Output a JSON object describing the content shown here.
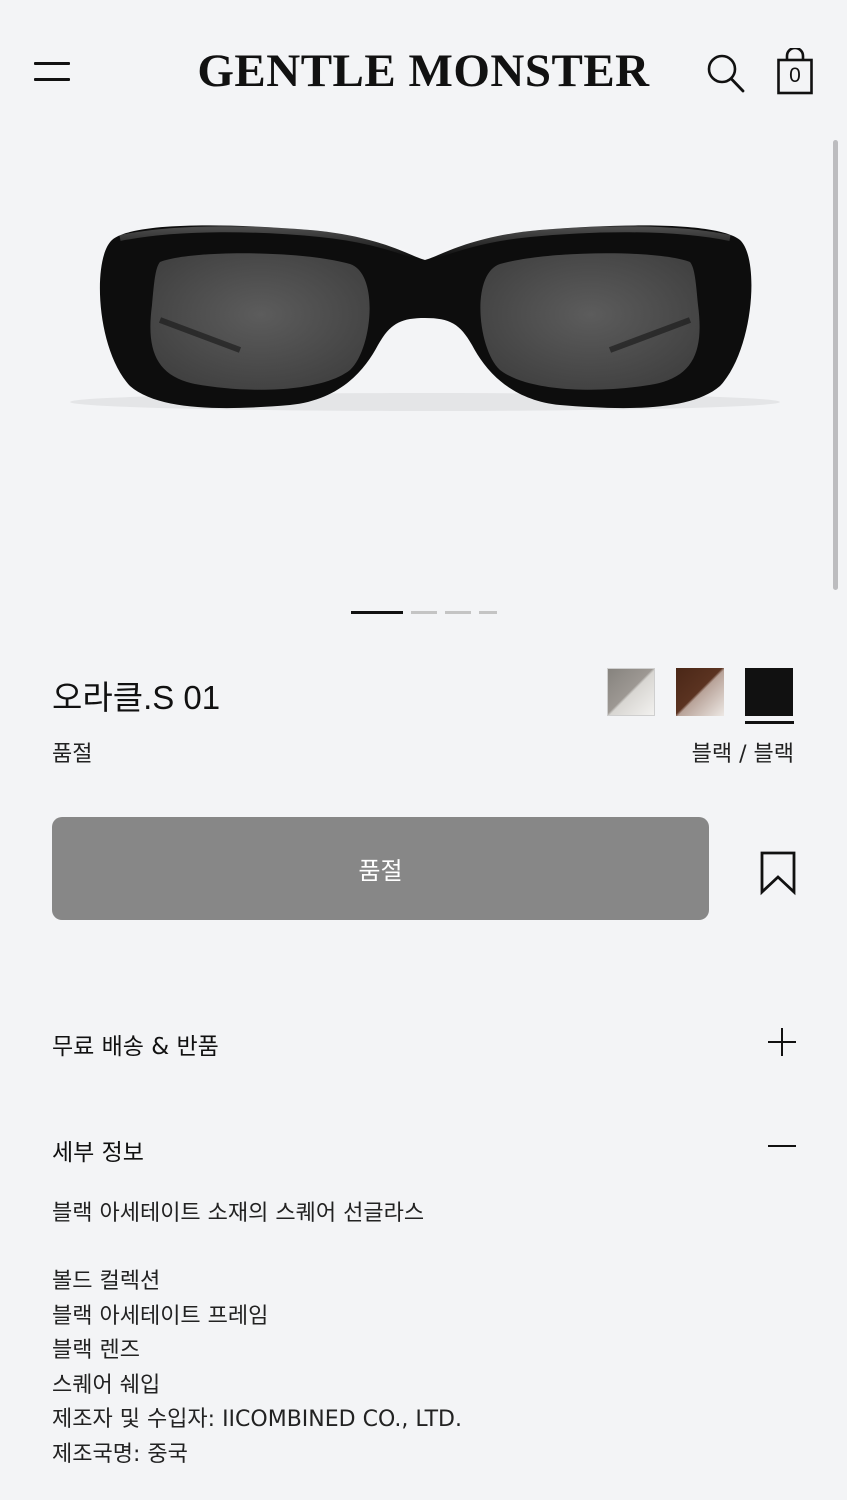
{
  "header": {
    "brand": "GENTLE MONSTER",
    "cart_count": "0",
    "icons": [
      "hamburger-menu-icon",
      "search-icon",
      "shopping-bag-icon"
    ]
  },
  "gallery": {
    "image": "black-oval-sunglasses",
    "total_slides": 4,
    "active_slide": 1
  },
  "product": {
    "name": "오라클.S 01",
    "status": "품절",
    "selected_color": "블랙 / 블랙",
    "swatches": [
      {
        "name": "grey",
        "colors": [
          "#8f8b86",
          "#f0efed"
        ]
      },
      {
        "name": "brown",
        "colors": [
          "#4f2a1a",
          "#ebe5e0"
        ]
      },
      {
        "name": "black",
        "colors": [
          "#111111"
        ],
        "selected": true
      }
    ]
  },
  "actions": {
    "buy_label": "품절",
    "bookmark_icon": "bookmark-icon"
  },
  "accordion": {
    "shipping": {
      "title": "무료 배송 & 반품",
      "state": "collapsed"
    },
    "details": {
      "title": "세부 정보",
      "state": "expanded",
      "lead": "블랙 아세테이트 소재의 스퀘어 선글라스",
      "lines": [
        "볼드 컬렉션",
        "블랙 아세테이트 프레임",
        "블랙 렌즈",
        "스퀘어 쉐입",
        "제조자 및 수입자: IICOMBINED CO., LTD.",
        "제조국명: 중국"
      ]
    }
  },
  "colors": {
    "background": "#f3f4f6",
    "text": "#111111",
    "button_disabled": "#878787",
    "pager_active": "#111111",
    "pager_inactive": "#c4c4c4"
  }
}
